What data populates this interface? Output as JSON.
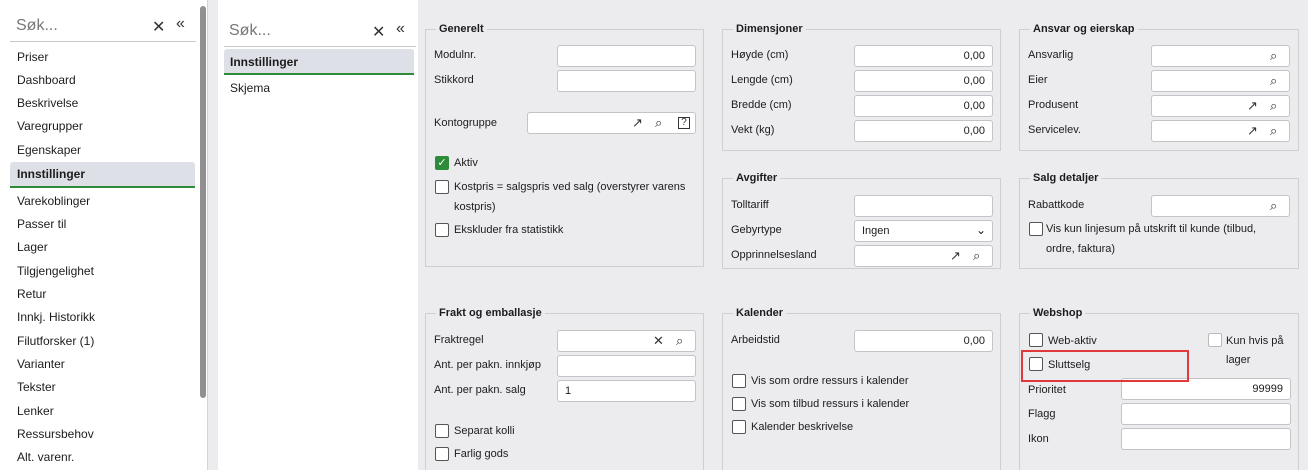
{
  "nav1": {
    "search_placeholder": "Søk...",
    "items": [
      "Priser",
      "Dashboard",
      "Beskrivelse",
      "Varegrupper",
      "Egenskaper",
      "Innstillinger",
      "Varekoblinger",
      "Passer til",
      "Lager",
      "Tilgjengelighet",
      "Retur",
      "Innkj. Historikk",
      "Filutforsker (1)",
      "Varianter",
      "Tekster",
      "Lenker",
      "Ressursbehov",
      "Alt. varenr."
    ],
    "selected": "Innstillinger"
  },
  "nav2": {
    "search_placeholder": "Søk...",
    "items": [
      "Innstillinger",
      "Skjema"
    ],
    "selected": "Innstillinger"
  },
  "generelt": {
    "title": "Generelt",
    "modulnr_label": "Modulnr.",
    "stikkord_label": "Stikkord",
    "kontogruppe_label": "Kontogruppe",
    "aktiv_label": "Aktiv",
    "kostpris_label_1": "Kostpris = salgspris ved salg (overstyrer varens",
    "kostpris_label_2": "kostpris)",
    "ekskluder_label": "Ekskluder fra statistikk"
  },
  "dimensjoner": {
    "title": "Dimensjoner",
    "rows": [
      {
        "label": "Høyde (cm)",
        "value": "0,00"
      },
      {
        "label": "Lengde (cm)",
        "value": "0,00"
      },
      {
        "label": "Bredde (cm)",
        "value": "0,00"
      },
      {
        "label": "Vekt (kg)",
        "value": "0,00"
      }
    ]
  },
  "ansvar": {
    "title": "Ansvar og eierskap",
    "ansvarlig_label": "Ansvarlig",
    "eier_label": "Eier",
    "produsent_label": "Produsent",
    "servicelev_label": "Servicelev."
  },
  "avgifter": {
    "title": "Avgifter",
    "tolltariff_label": "Tolltariff",
    "gebyrtype_label": "Gebyrtype",
    "gebyrtype_value": "Ingen",
    "opprinnelsesland_label": "Opprinnelsesland"
  },
  "salg": {
    "title": "Salg detaljer",
    "rabattkode_label": "Rabattkode",
    "vis_label_1": "Vis kun linjesum på utskrift til kunde (tilbud,",
    "vis_label_2": "ordre, faktura)"
  },
  "frakt": {
    "title": "Frakt og emballasje",
    "fraktregel_label": "Fraktregel",
    "innkjop_label": "Ant. per pakn. innkjøp",
    "salg_label": "Ant. per pakn. salg",
    "salg_value": "1",
    "separat_label": "Separat kolli",
    "farlig_label": "Farlig gods"
  },
  "kalender": {
    "title": "Kalender",
    "arbeidstid_label": "Arbeidstid",
    "arbeidstid_value": "0,00",
    "ordre_label": "Vis som ordre ressurs i kalender",
    "tilbud_label": "Vis som tilbud ressurs i kalender",
    "beskrivelse_label": "Kalender beskrivelse"
  },
  "webshop": {
    "title": "Webshop",
    "webaktiv_label": "Web-aktiv",
    "kunlager_label_1": "Kun hvis på",
    "kunlager_label_2": "lager",
    "sluttselg_label": "Sluttselg",
    "prioritet_label": "Prioritet",
    "prioritet_value": "99999",
    "flagg_label": "Flagg",
    "ikon_label": "Ikon"
  },
  "colors": {
    "accent": "#2e8b3a",
    "highlight": "#e0393b"
  }
}
